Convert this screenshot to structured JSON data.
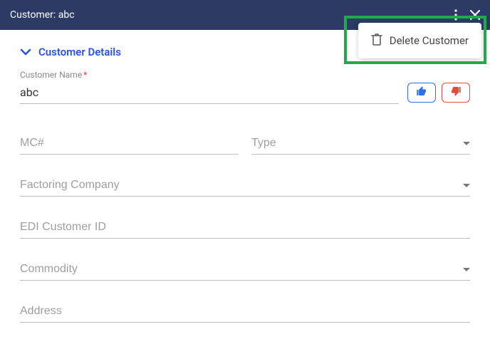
{
  "header": {
    "title": "Customer: abc"
  },
  "popover": {
    "delete_label": "Delete Customer"
  },
  "section": {
    "title": "Customer Details"
  },
  "fields": {
    "name_label": "Customer Name",
    "name_value": "abc",
    "mc_placeholder": "MC#",
    "type_placeholder": "Type",
    "factoring_placeholder": "Factoring Company",
    "edi_placeholder": "EDI Customer ID",
    "commodity_placeholder": "Commodity",
    "address_placeholder": "Address"
  }
}
